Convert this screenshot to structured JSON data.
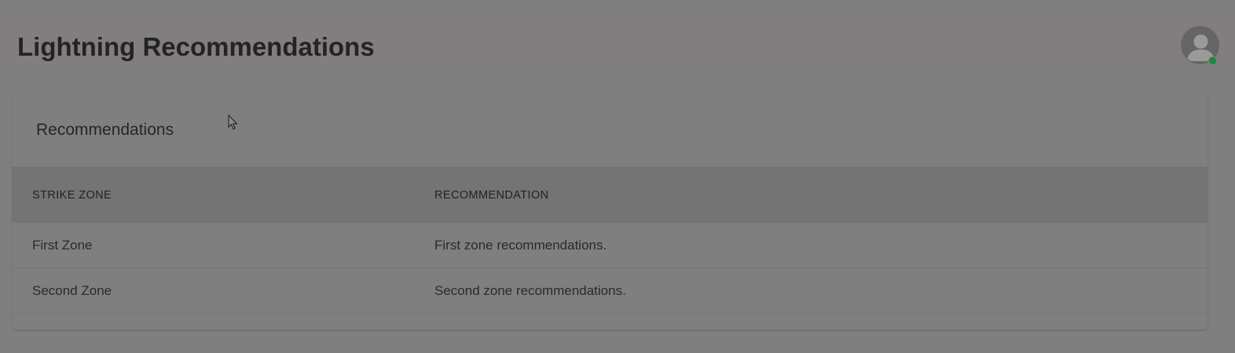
{
  "header": {
    "title": "Lightning Recommendations",
    "avatar_icon": "user-avatar-icon",
    "status": "online",
    "status_color": "#1e8a3c"
  },
  "card": {
    "title": "Recommendations",
    "columns": [
      "STRIKE ZONE",
      "RECOMMENDATION"
    ],
    "rows": [
      {
        "zone": "First Zone",
        "recommendation": "First zone recommendations."
      },
      {
        "zone": "Second Zone",
        "recommendation": "Second zone recommendations."
      }
    ]
  }
}
